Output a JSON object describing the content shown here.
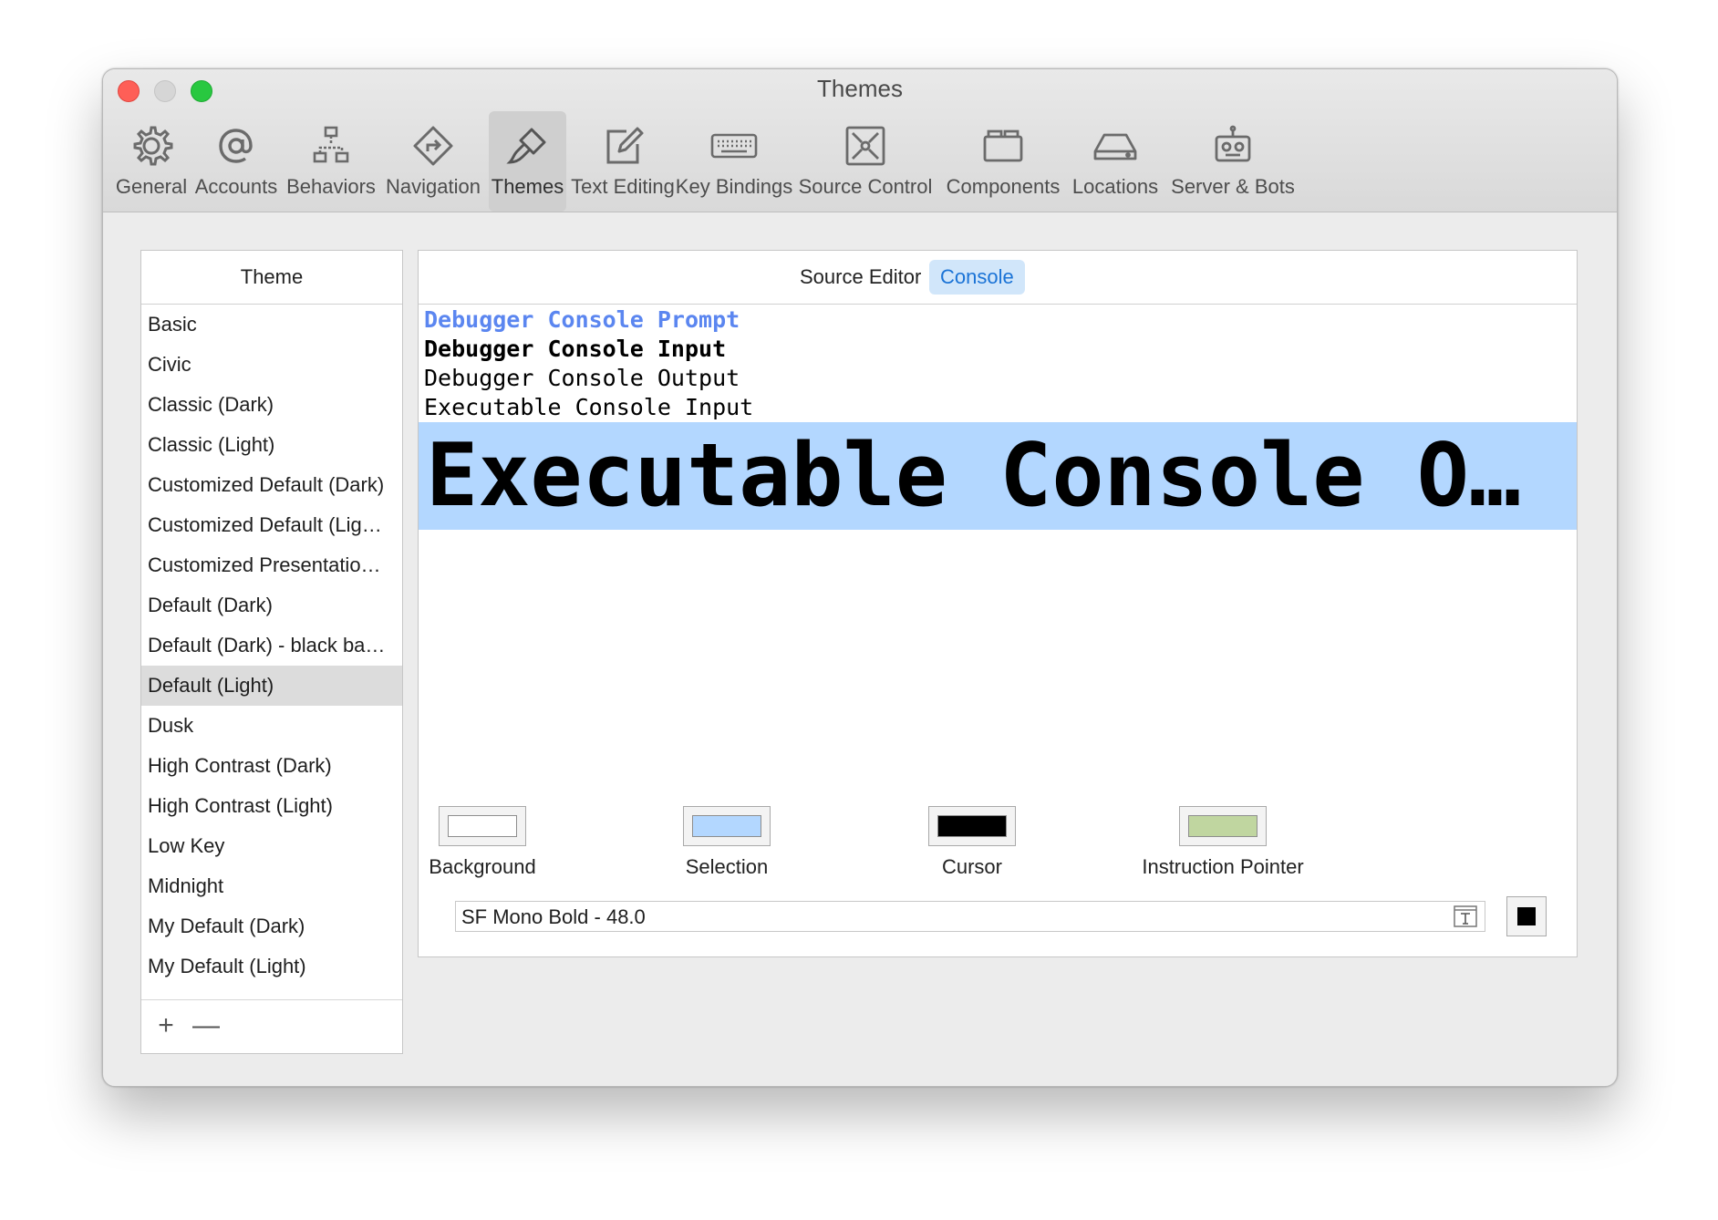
{
  "window": {
    "title": "Themes"
  },
  "toolbar": {
    "items": [
      {
        "label": "General",
        "icon": "gear-icon"
      },
      {
        "label": "Accounts",
        "icon": "at-icon"
      },
      {
        "label": "Behaviors",
        "icon": "hierarchy-icon"
      },
      {
        "label": "Navigation",
        "icon": "navigation-arrow-icon"
      },
      {
        "label": "Themes",
        "icon": "paintbrush-icon",
        "active": true
      },
      {
        "label": "Text Editing",
        "icon": "pencil-square-icon"
      },
      {
        "label": "Key Bindings",
        "icon": "keyboard-icon"
      },
      {
        "label": "Source Control",
        "icon": "source-control-icon"
      },
      {
        "label": "Components",
        "icon": "components-box-icon"
      },
      {
        "label": "Locations",
        "icon": "drive-icon"
      },
      {
        "label": "Server & Bots",
        "icon": "robot-icon"
      }
    ]
  },
  "themes": {
    "header": "Theme",
    "items": [
      "Basic",
      "Civic",
      "Classic (Dark)",
      "Classic (Light)",
      "Customized Default (Dark)",
      "Customized Default (Lig…",
      "Customized Presentatio…",
      "Default (Dark)",
      "Default (Dark) - black ba…",
      "Default (Light)",
      "Dusk",
      "High Contrast (Dark)",
      "High Contrast (Light)",
      "Low Key",
      "Midnight",
      "My Default (Dark)",
      "My Default (Light)"
    ],
    "selected": "Default (Light)",
    "add_label": "+",
    "remove_label": "—"
  },
  "editor": {
    "tabs": {
      "source_editor": "Source Editor",
      "console": "Console"
    },
    "selected_tab": "Console",
    "lines": {
      "prompt": "Debugger Console Prompt",
      "input": "Debugger Console Input",
      "output": "Debugger Console Output",
      "exec_input": "Executable Console Input",
      "exec_output": "Executable Console O…"
    },
    "font_value": "SF Mono Bold - 48.0",
    "font_color": "#000000"
  },
  "colors": {
    "background": {
      "label": "Background",
      "color": "#ffffff"
    },
    "selection": {
      "label": "Selection",
      "color": "#b3d7ff"
    },
    "cursor": {
      "label": "Cursor",
      "color": "#000000"
    },
    "instruction_pointer": {
      "label": "Instruction Pointer",
      "color": "#c0d6a0"
    },
    "prompt_color": "#5b86f0",
    "accent": "#1a73d6"
  }
}
